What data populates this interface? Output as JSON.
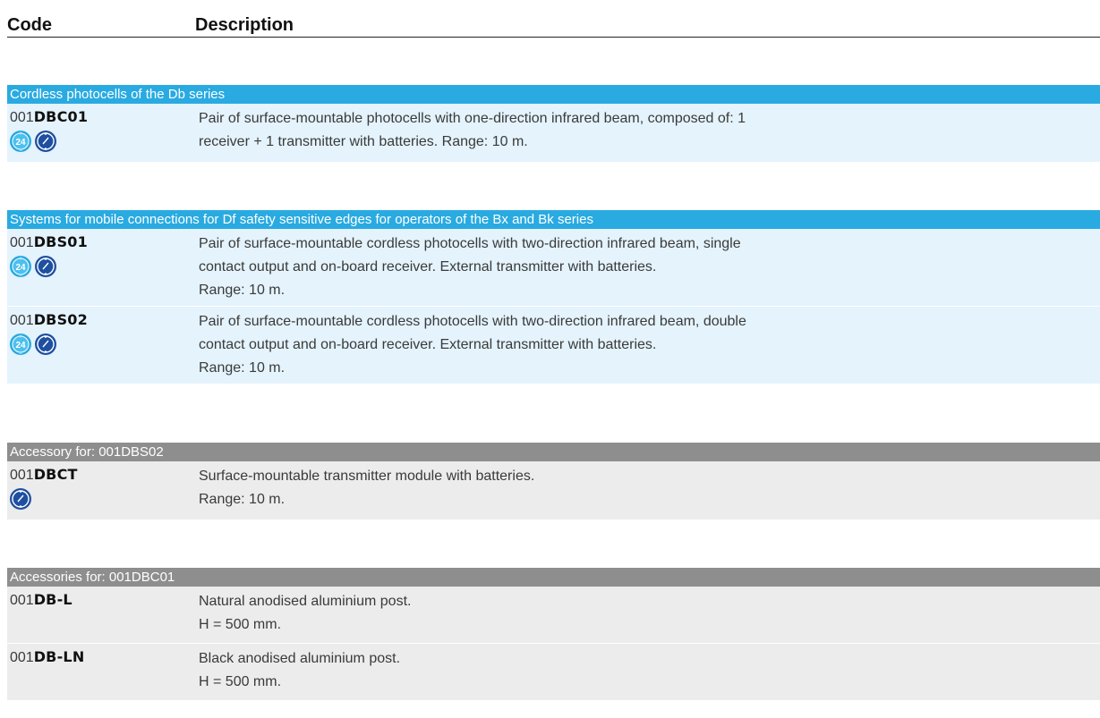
{
  "header": {
    "code": "Code",
    "description": "Description"
  },
  "sections": [
    {
      "title": "Cordless photocells of the Db series",
      "rows": [
        {
          "prefix": "001",
          "code": "DBC01",
          "line1": "Pair of surface-mountable photocells with one-direction infrared beam, composed of: 1",
          "line2": "receiver + 1 transmitter with batteries. Range: 10 m.",
          "line3": ""
        }
      ]
    },
    {
      "title": "Systems for mobile connections for Df safety sensitive edges for operators of the Bx and Bk series",
      "rows": [
        {
          "prefix": "001",
          "code": "DBS01",
          "line1": "Pair of surface-mountable cordless photocells with two-direction infrared beam, single",
          "line2": "contact output and on-board receiver. External transmitter with batteries.",
          "line3": "Range: 10 m."
        },
        {
          "prefix": "001",
          "code": "DBS02",
          "line1": "Pair of surface-mountable cordless photocells with two-direction infrared beam, double",
          "line2": "contact output and on-board receiver. External transmitter with batteries.",
          "line3": "Range: 10 m."
        }
      ]
    },
    {
      "title": "Accessory for: 001DBS02",
      "rows": [
        {
          "prefix": "001",
          "code": "DBCT",
          "line1": "Surface-mountable transmitter module with batteries.",
          "line2": "Range: 10 m.",
          "line3": ""
        }
      ]
    },
    {
      "title": "Accessories for: 001DBC01",
      "rows": [
        {
          "prefix": "001",
          "code": "DB-L",
          "line1": "Natural anodised aluminium post.",
          "line2": "H = 500 mm.",
          "line3": ""
        },
        {
          "prefix": "001",
          "code": "DB-LN",
          "line1": "Black anodised aluminium post.",
          "line2": "H = 500 mm.",
          "line3": ""
        }
      ]
    }
  ],
  "icons": {
    "power_24v": {
      "name": "24v-power-icon",
      "label": "24",
      "color": "#29aae1"
    },
    "battery": {
      "name": "battery-transmitter-icon",
      "color": "#1e4fa0"
    }
  },
  "colors": {
    "blue_band": "#29aae1",
    "blue_row": "#e4f3fc",
    "gray_band": "#8e8e8e",
    "gray_row": "#ececec"
  }
}
